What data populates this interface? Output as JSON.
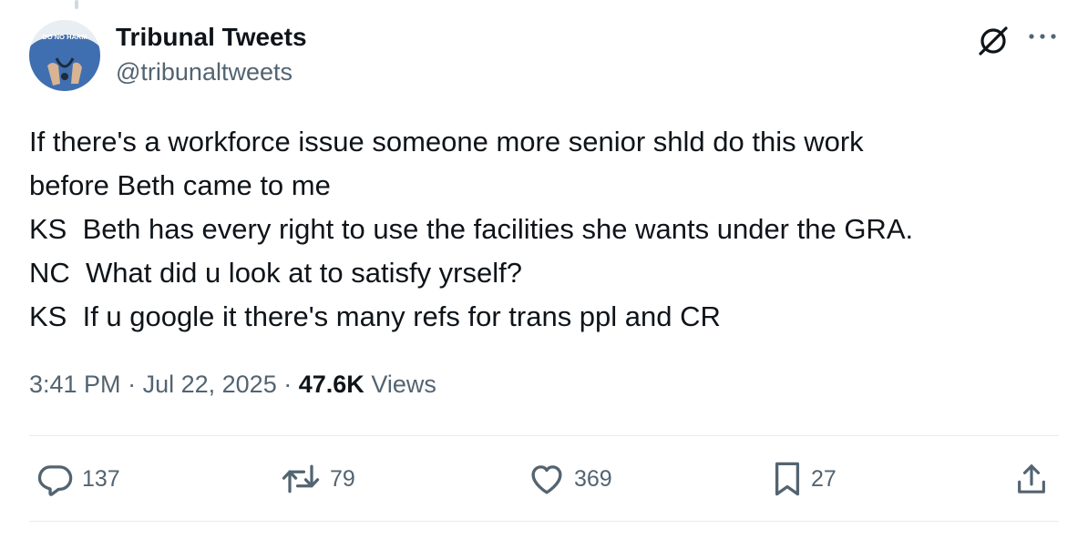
{
  "author": {
    "display_name": "Tribunal Tweets",
    "handle": "@tribunaltweets",
    "avatar_badge_text": "DO NO HARM"
  },
  "tweet": {
    "lines": [
      "If there's a workforce issue someone more senior shld do this work",
      "before Beth came to me",
      "KS  Beth has every right to use the facilities she wants under the GRA.",
      "NC  What did u look at to satisfy yrself?",
      "KS  If u google it there's many refs for trans ppl and CR"
    ]
  },
  "meta": {
    "time": "3:41 PM",
    "separator": "·",
    "date": "Jul 22, 2025",
    "views_count": "47.6K",
    "views_label": "Views"
  },
  "actions": {
    "replies": "137",
    "reposts": "79",
    "likes": "369",
    "bookmarks": "27"
  },
  "icons": {
    "header_right": [
      "grok-icon",
      "more-icon"
    ],
    "action_bar": [
      "reply-icon",
      "repost-icon",
      "like-icon",
      "bookmark-icon",
      "share-icon"
    ]
  },
  "colors": {
    "text_primary": "#0f1419",
    "text_secondary": "#536471",
    "divider": "#e6ecf0",
    "avatar_shirt": "#3f6fb0"
  }
}
